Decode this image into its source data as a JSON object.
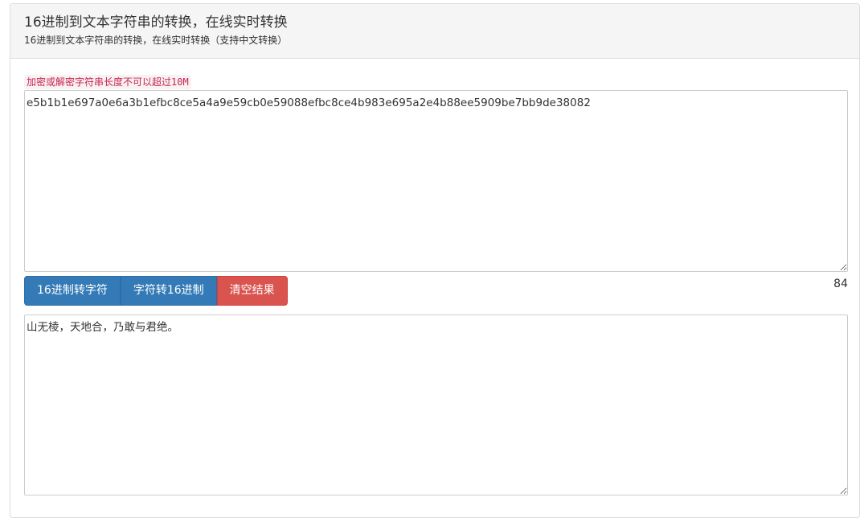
{
  "header": {
    "title": "16进制到文本字符串的转换，在线实时转换",
    "subtitle": "16进制到文本字符串的转换，在线实时转换（支持中文转换）"
  },
  "hint": "加密或解密字符串长度不可以超过10M",
  "input": {
    "value": "e5b1b1e697a0e6a3b1efbc8ce5a4a9e59cb0e59088efbc8ce4b983e695a2e4b88ee5909be7bb9de38082"
  },
  "toolbar": {
    "hex_to_text_label": "16进制转字符",
    "text_to_hex_label": "字符转16进制",
    "clear_label": "清空结果"
  },
  "char_count": "84",
  "output": {
    "value": "山无棱，天地合，乃敢与君绝。"
  },
  "colors": {
    "primary": "#337ab7",
    "danger": "#d9534f",
    "hint_text": "#c7254e",
    "hint_bg": "#f9f2f4",
    "heading_bg": "#f5f5f5"
  }
}
